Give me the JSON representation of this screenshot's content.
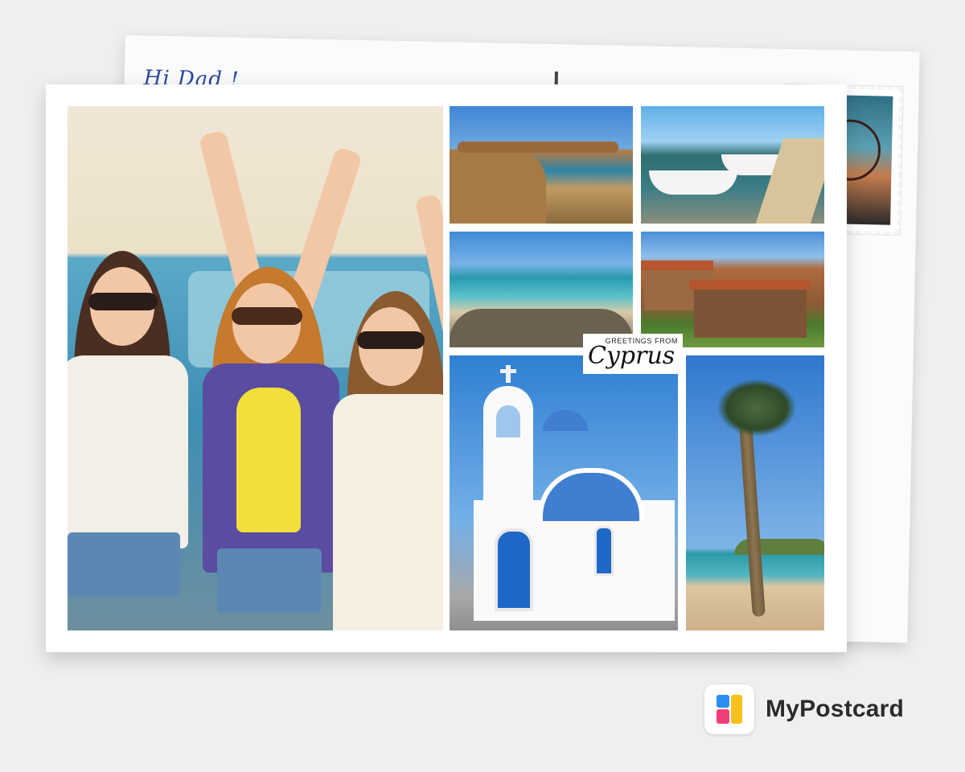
{
  "back_card": {
    "handwriting": "Hi Dad !",
    "stamp": {
      "icon": "golden-gate-bridge-stamp"
    }
  },
  "front_card": {
    "photos": [
      {
        "id": "main",
        "subject": "three-women-peace-signs"
      },
      {
        "id": "coast1",
        "subject": "rocky-coastline"
      },
      {
        "id": "harbor",
        "subject": "fishing-boats-harbor"
      },
      {
        "id": "beach",
        "subject": "sandy-beach-cove"
      },
      {
        "id": "village",
        "subject": "stone-village-houses"
      },
      {
        "id": "church",
        "subject": "white-chapel-blue-dome"
      },
      {
        "id": "palm",
        "subject": "palm-tree-beach"
      }
    ],
    "greeting": {
      "sub": "GREETINGS FROM",
      "main": "Cyprus"
    }
  },
  "brand": {
    "name": "MyPostcard",
    "logo_colors": {
      "blue": "#2b8ff0",
      "yellow": "#f7c21a",
      "pink": "#f23d7d"
    }
  }
}
